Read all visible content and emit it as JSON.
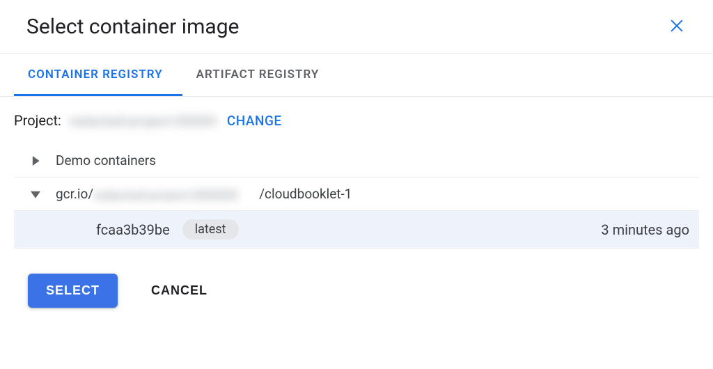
{
  "dialog": {
    "title": "Select container image"
  },
  "tabs": {
    "container_registry": "CONTAINER REGISTRY",
    "artifact_registry": "ARTIFACT REGISTRY"
  },
  "project": {
    "label": "Project:",
    "value": "redacted-project-000000",
    "change": "CHANGE"
  },
  "tree": {
    "demo": "Demo containers",
    "repo_prefix": "gcr.io/",
    "repo_redacted": "redacted-project-000000",
    "repo_suffix": "/cloudbooklet-1"
  },
  "version": {
    "hash": "fcaa3b39be",
    "tag": "latest",
    "age": "3 minutes ago"
  },
  "actions": {
    "select": "SELECT",
    "cancel": "CANCEL"
  }
}
